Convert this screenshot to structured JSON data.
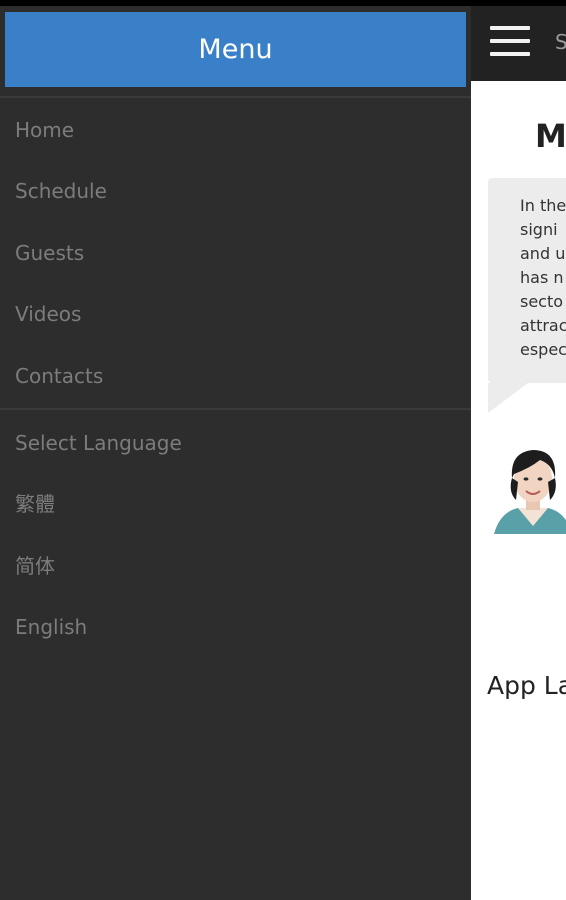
{
  "drawer": {
    "title": "Menu",
    "nav_items": [
      "Home",
      "Schedule",
      "Guests",
      "Videos",
      "Contacts"
    ],
    "language_header": "Select Language",
    "languages": [
      "繁體",
      "简体",
      "English"
    ]
  },
  "main": {
    "bar_title_partial": "S",
    "heading_partial": "M",
    "bubble_lines": [
      "In the",
      "signi",
      "and u",
      "has n",
      "secto",
      "attrac",
      "espec"
    ],
    "app_label_partial": "App La"
  },
  "colors": {
    "menu_header": "#3a80c9",
    "drawer_bg": "#2d2d2d",
    "item_text": "#7c7c7c"
  }
}
